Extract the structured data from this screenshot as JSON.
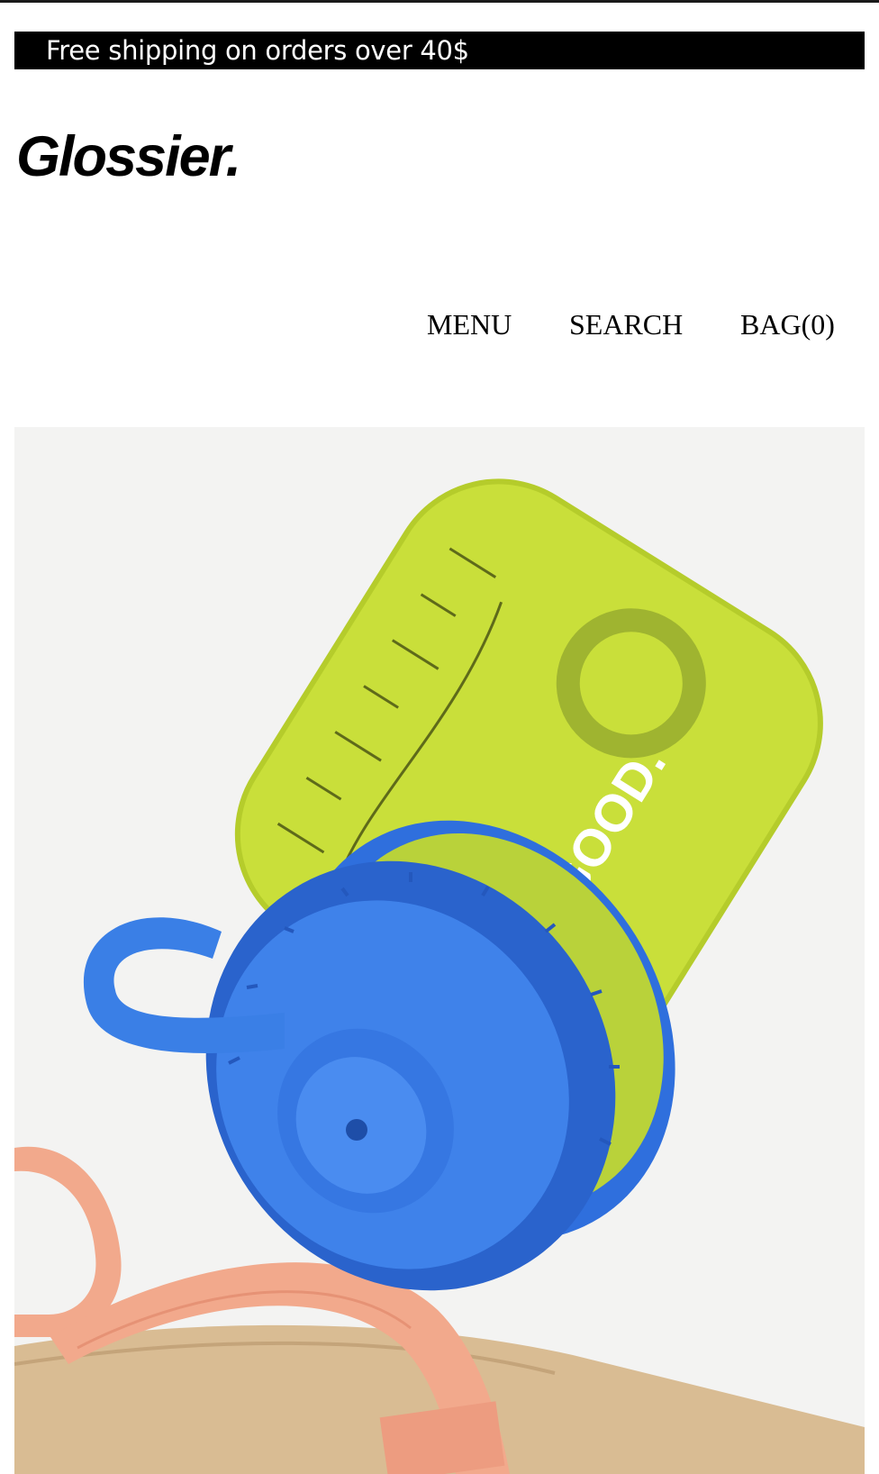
{
  "announcement": {
    "text": "Free shipping on orders over 40$"
  },
  "brand": {
    "logo_text": "Glossier."
  },
  "nav": {
    "menu_label": "MENU",
    "search_label": "SEARCH",
    "bag_label": "BAG(0)"
  },
  "hero": {
    "bottle_text": "OK GOOD.",
    "colors": {
      "background": "#f3f3f2",
      "bottle": "#c9df3a",
      "cap": "#2f6fdd",
      "strap": "#f2a98c",
      "bag": "#d9bc93"
    },
    "icons": [
      "water-bottle-image",
      "tote-strap-image"
    ]
  }
}
